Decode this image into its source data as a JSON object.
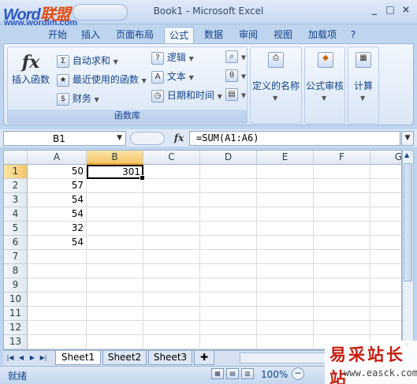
{
  "watermark": {
    "brand_part1": "Word",
    "brand_part2": "联盟",
    "url": "www.wordlm.com"
  },
  "window": {
    "title": "Book1 - Microsoft Excel",
    "buttons": [
      "_",
      "□",
      "×"
    ]
  },
  "ribbon_tabs": [
    "开始",
    "插入",
    "页面布局",
    "公式",
    "数据",
    "审阅",
    "视图",
    "加载项"
  ],
  "active_tab": "公式",
  "ribbon": {
    "insert_function": "插入函数",
    "autosum": "自动求和",
    "recent": "最近使用的函数",
    "financial": "财务",
    "logical": "逻辑",
    "text": "文本",
    "datetime": "日期和时间",
    "defined_names": "定义的名称",
    "formula_audit": "公式审核",
    "calculation": "计算",
    "group_label": "函数库"
  },
  "formula_bar": {
    "name_box": "B1",
    "fx": "fx",
    "formula": "=SUM(A1:A6)"
  },
  "columns": [
    "A",
    "B",
    "C",
    "D",
    "E",
    "F",
    "G"
  ],
  "selected_column": "B",
  "rows": [
    "1",
    "2",
    "3",
    "4",
    "5",
    "6",
    "7",
    "8",
    "9",
    "10",
    "11",
    "12",
    "13"
  ],
  "cells": {
    "A": [
      "50",
      "57",
      "54",
      "54",
      "32",
      "54"
    ],
    "B1": "301"
  },
  "sheet_tabs": [
    "Sheet1",
    "Sheet2",
    "Sheet3"
  ],
  "active_sheet": "Sheet1",
  "status": {
    "ready": "就绪",
    "zoom": "100%"
  },
  "stamp": {
    "title": "易采站长站",
    "url": "www.easck.com"
  }
}
